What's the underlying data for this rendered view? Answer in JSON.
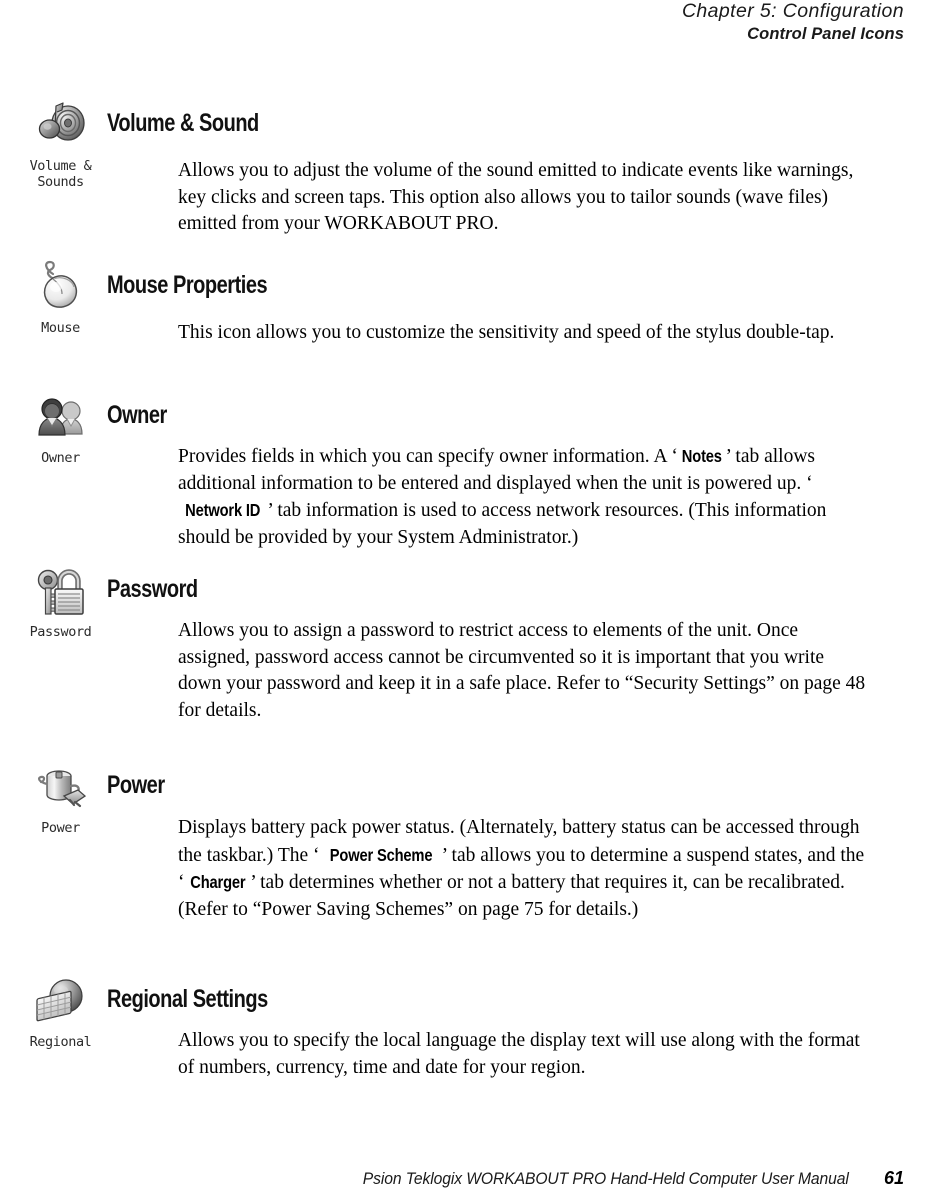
{
  "header": {
    "chapter": "Chapter 5: Configuration",
    "section": "Control Panel Icons"
  },
  "footer": {
    "manual": "Psion Teklogix WORKABOUT PRO Hand-Held Computer User Manual",
    "page": "61"
  },
  "entries": [
    {
      "id": "volume-and-sound",
      "icon_name": "volume-and-sounds-icon",
      "icon_label": "Volume &\nSounds",
      "heading": "Volume & Sound",
      "body_segments": [
        {
          "type": "text",
          "text": "Allows you to adjust the volume of the sound emitted to indicate events like warnings, key clicks and screen taps. This option also allows you to tailor sounds (wave files) emitted from your WORKABOUT PRO."
        }
      ]
    },
    {
      "id": "mouse-properties",
      "icon_name": "mouse-icon",
      "icon_label": "Mouse",
      "heading": "Mouse Properties",
      "body_segments": [
        {
          "type": "text",
          "text": "This icon allows you to customize the sensitivity and speed of the stylus double-tap."
        }
      ]
    },
    {
      "id": "owner",
      "icon_name": "owner-icon",
      "icon_label": "Owner",
      "heading": "Owner",
      "body_segments": [
        {
          "type": "text",
          "text": "Provides fields in which you can specify owner information. A ‘"
        },
        {
          "type": "tab",
          "text": "Notes"
        },
        {
          "type": "text",
          "text": "’ tab allows additional information to be entered and displayed when the unit is powered up. ‘"
        },
        {
          "type": "tab",
          "text": "Network ID"
        },
        {
          "type": "text",
          "text": "’ tab information is used to access network resources. (This information should be provided by your System Administrator.)"
        }
      ]
    },
    {
      "id": "password",
      "icon_name": "password-icon",
      "icon_label": "Password",
      "heading": "Password",
      "body_segments": [
        {
          "type": "text",
          "text": "Allows you to assign a password to restrict access to elements of the unit. Once assigned, password access cannot be circumvented so it is important that you write down your password and keep it in a safe place. Refer to “Security Settings” on page 48 for details."
        }
      ]
    },
    {
      "id": "power",
      "icon_name": "power-icon",
      "icon_label": "Power",
      "heading": "Power",
      "body_segments": [
        {
          "type": "text",
          "text": "Displays battery pack power status. (Alternately, battery status can be accessed through the taskbar.) The ‘"
        },
        {
          "type": "tab",
          "text": "Power Scheme"
        },
        {
          "type": "text",
          "text": "’ tab allows you to determine a suspend states, and the ‘"
        },
        {
          "type": "tab",
          "text": "Charger"
        },
        {
          "type": "text",
          "text": "’ tab determines whether or not a battery that requires it, can be recalibrated. (Refer to “Power Saving Schemes” on page 75 for details.)"
        }
      ]
    },
    {
      "id": "regional-settings",
      "icon_name": "regional-icon",
      "icon_label": "Regional",
      "heading": "Regional Settings",
      "body_segments": [
        {
          "type": "text",
          "text": "Allows you to specify the local language the display text will use along with the format of numbers, currency, time and date for your region."
        }
      ]
    }
  ],
  "colors": {
    "text": "#000000",
    "header": "#1a1a1a",
    "icon_label": "#2b2b2b"
  }
}
